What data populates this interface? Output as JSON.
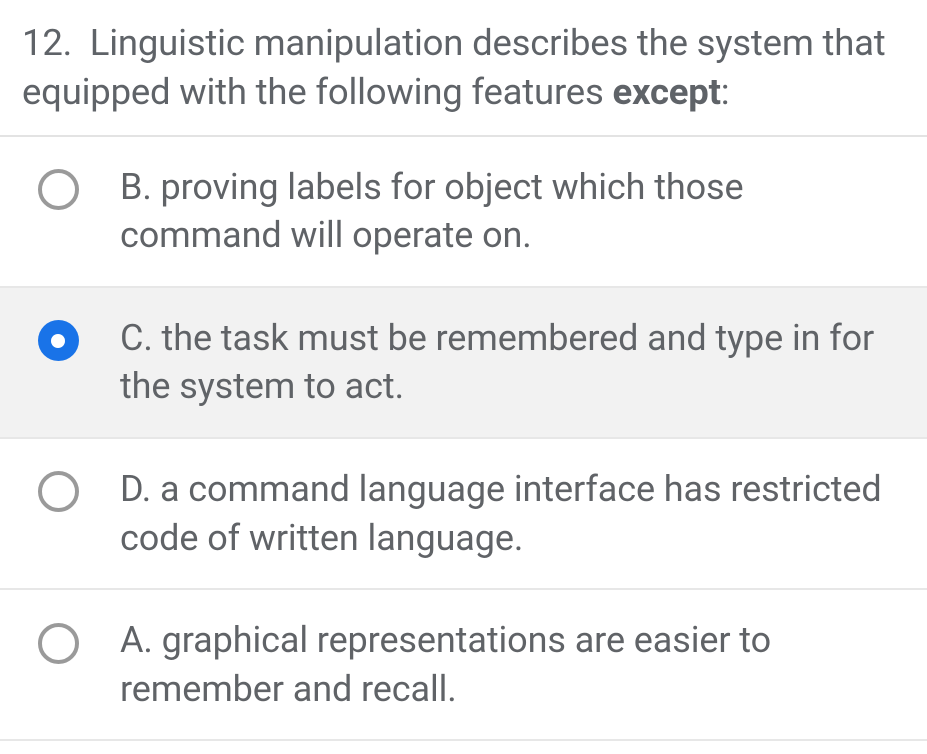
{
  "question": {
    "number": "12.",
    "stem_pre": "Linguistic manipulation describes the system that equipped with the following features ",
    "stem_bold": "except",
    "stem_post": ":"
  },
  "options": [
    {
      "label": "B. proving labels for object which those command will operate on.",
      "selected": false
    },
    {
      "label": "C. the task must be remembered and type in for the system to act.",
      "selected": true
    },
    {
      "label": "D. a command language interface has restricted code of written language.",
      "selected": false
    },
    {
      "label": "A. graphical representations are easier to remember and recall.",
      "selected": false
    }
  ]
}
